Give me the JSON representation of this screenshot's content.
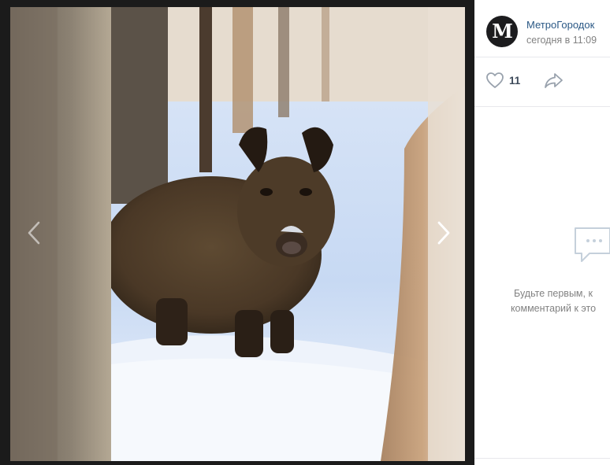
{
  "post": {
    "author": "МетроГородок",
    "avatar_letter": "M",
    "date": "сегодня в 11:09",
    "likes": "11"
  },
  "comments": {
    "empty_line1": "Будьте первым, к",
    "empty_line2": "комментарий к это"
  },
  "icons": {
    "prev": "chevron-left-icon",
    "next": "chevron-right-icon",
    "like": "heart-icon",
    "share": "share-arrow-icon",
    "comments": "chat-bubble-icon"
  }
}
